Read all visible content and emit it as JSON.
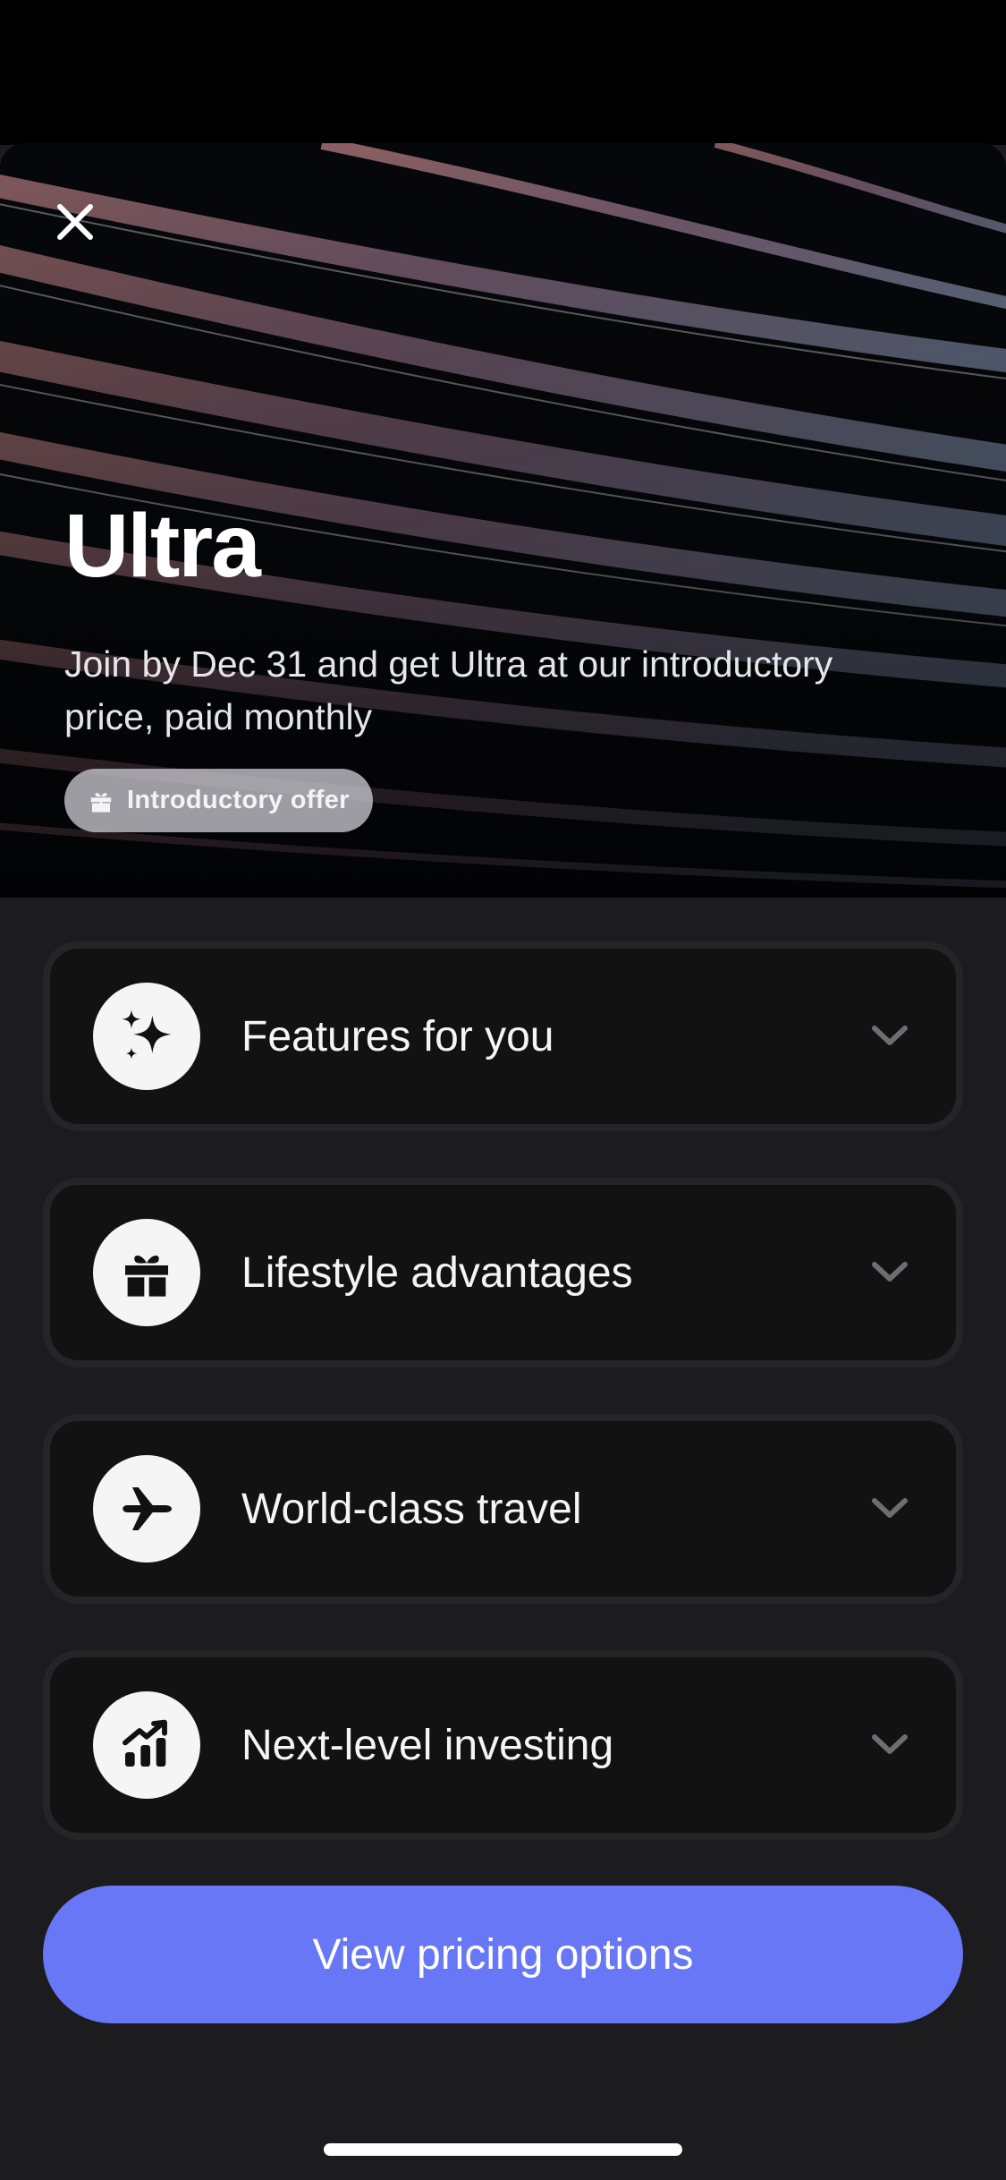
{
  "header": {
    "title": "Ultra",
    "subtitle": "Join by Dec 31 and get Ultra at our introductory price, paid monthly",
    "badge": {
      "icon": "gift-icon",
      "label": "Introductory offer"
    }
  },
  "close_icon": "close-icon",
  "sections": [
    {
      "icon": "sparkles-icon",
      "label": "Features for you"
    },
    {
      "icon": "gift-icon",
      "label": "Lifestyle advantages"
    },
    {
      "icon": "airplane-icon",
      "label": "World-class travel"
    },
    {
      "icon": "chart-growth-icon",
      "label": "Next-level investing"
    }
  ],
  "cta": {
    "label": "View pricing options",
    "color": "#6877f6"
  },
  "colors": {
    "background": "#1c1c1e",
    "card": "#121213",
    "card_border": "#252527"
  }
}
